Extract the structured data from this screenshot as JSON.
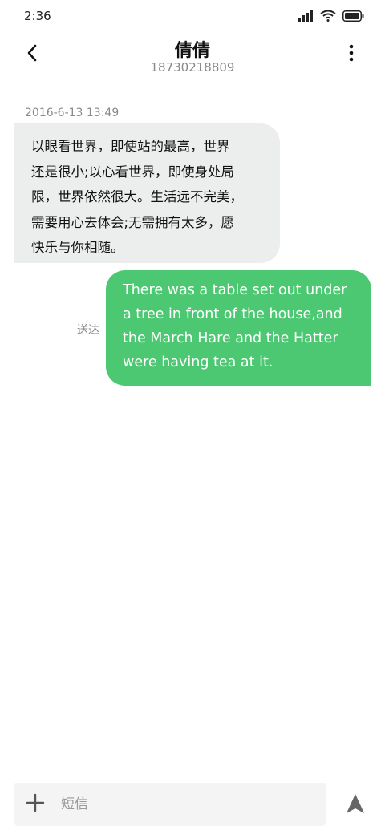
{
  "status_bar": {
    "time": "2:36"
  },
  "header": {
    "contact_name": "倩倩",
    "contact_number": "18730218809",
    "back_icon": "chevron-left-icon",
    "more_icon": "more-vertical-icon"
  },
  "conversation": {
    "timestamp": "2016-6-13 13:49",
    "messages": [
      {
        "direction": "incoming",
        "lines": [
          "以眼看世界，即使站的最高，世界",
          "还是很小;以心看世界，即使身处局",
          "限，世界依然很大。生活远不完美，",
          "需要用心去体会;无需拥有太多，愿",
          "快乐与你相随。"
        ]
      },
      {
        "direction": "outgoing",
        "status": "送达",
        "lines": [
          "There was a table set out under",
          "a tree in front of the house,and",
          "the March Hare and the Hatter",
          "were having tea at it."
        ]
      }
    ]
  },
  "composer": {
    "placeholder": "短信",
    "add_icon": "plus-icon",
    "send_icon": "send-icon"
  },
  "colors": {
    "incoming_bubble": "#eceeed",
    "outgoing_bubble": "#4bc871"
  }
}
